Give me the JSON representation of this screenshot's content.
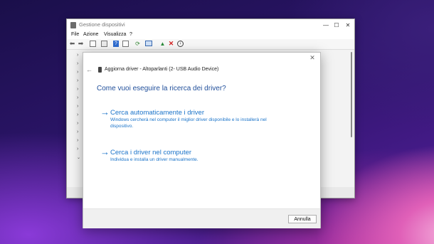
{
  "window": {
    "title": "Gestione dispositivi",
    "controls": {
      "minimize": "—",
      "maximize": "☐",
      "close": "✕"
    },
    "menu": [
      "File",
      "Azione",
      "Visualizza",
      "?"
    ],
    "toolbar_icons": [
      "back-arrow-icon",
      "forward-arrow-icon",
      "properties-icon",
      "list-icon",
      "help-icon",
      "view-icon",
      "scan-icon",
      "monitor-icon",
      "update-driver-icon",
      "uninstall-icon",
      "disable-icon"
    ]
  },
  "dialog": {
    "title": "Aggiorna driver - Altoparlanti (2- USB Audio Device)",
    "heading": "Come vuoi eseguire la ricerca dei driver?",
    "options": [
      {
        "label": "Cerca automaticamente i driver",
        "description": "Windows cercherà nel computer il miglior driver disponibile e lo installerà nel dispositivo."
      },
      {
        "label": "Cerca i driver nel computer",
        "description": "Individua e installa un driver manualmente."
      }
    ],
    "cancel_label": "Annulla",
    "close_glyph": "✕",
    "back_glyph": "←"
  },
  "colors": {
    "accent": "#1a73c9",
    "heading": "#1f4e9a"
  }
}
